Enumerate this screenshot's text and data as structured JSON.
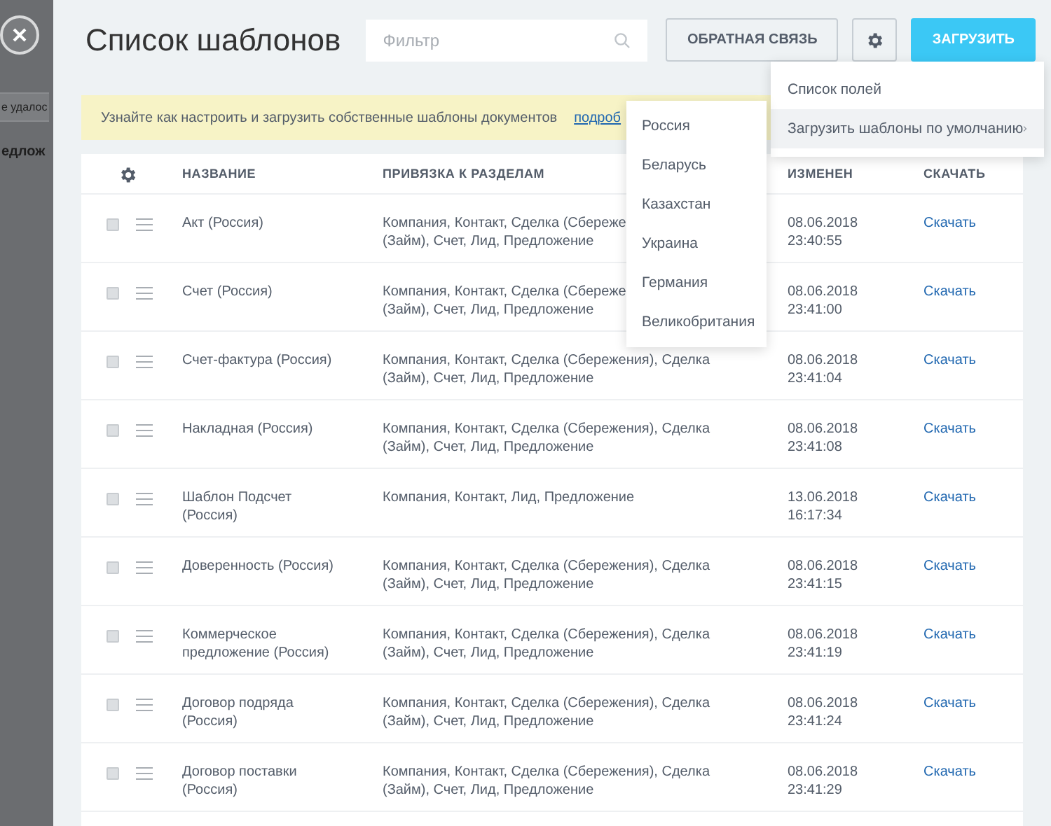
{
  "background_page": {
    "notice": "е удалос",
    "heading": "едлож"
  },
  "title": "Список шаблонов",
  "filter": {
    "placeholder": "Фильтр"
  },
  "buttons": [
    {
      "kind": "outline",
      "label": "ОБРАТНАЯ СВЯЗЬ"
    },
    {
      "kind": "gear"
    },
    {
      "kind": "primary",
      "label": "ЗАГРУЗИТЬ"
    }
  ],
  "banner": {
    "text": "Узнайте как настроить и загрузить собственные шаблоны документов",
    "link": "подроб"
  },
  "table": {
    "columns": [
      "НАЗВАНИЕ",
      "ПРИВЯЗКА К РАЗДЕЛАМ",
      "ИЗМЕНЕН",
      "СКАЧАТЬ"
    ],
    "rows": [
      {
        "checked": false,
        "name": "Акт (Россия)",
        "sections": "Компания, Контакт, Сделка (Сбереже\n(Займ), Счет, Лид, Предложение",
        "modified": "08.06.2018\n23:40:55",
        "download": "Скачать"
      },
      {
        "checked": false,
        "name": "Счет (Россия)",
        "sections": "Компания, Контакт, Сделка (Сбереже\n(Займ), Счет, Лид, Предложение",
        "modified": "08.06.2018\n23:41:00",
        "download": "Скачать"
      },
      {
        "checked": false,
        "name": "Счет-фактура (Россия)",
        "sections": "Компания, Контакт, Сделка (Сбережения), Сделка\n(Займ), Счет, Лид, Предложение",
        "modified": "08.06.2018\n23:41:04",
        "download": "Скачать"
      },
      {
        "checked": false,
        "name": "Накладная (Россия)",
        "sections": "Компания, Контакт, Сделка (Сбережения), Сделка\n(Займ), Счет, Лид, Предложение",
        "modified": "08.06.2018\n23:41:08",
        "download": "Скачать"
      },
      {
        "checked": false,
        "name": "Шаблон Подсчет\n(Россия)",
        "sections": "Компания, Контакт, Лид, Предложение",
        "modified": "13.06.2018\n16:17:34",
        "download": "Скачать"
      },
      {
        "checked": false,
        "name": "Доверенность (Россия)",
        "sections": "Компания, Контакт, Сделка (Сбережения), Сделка\n(Займ), Счет, Лид, Предложение",
        "modified": "08.06.2018\n23:41:15",
        "download": "Скачать"
      },
      {
        "checked": false,
        "name": "Коммерческое\nпредложение (Россия)",
        "sections": "Компания, Контакт, Сделка (Сбережения), Сделка\n(Займ), Счет, Лид, Предложение",
        "modified": "08.06.2018\n23:41:19",
        "download": "Скачать"
      },
      {
        "checked": false,
        "name": "Договор подряда\n(Россия)",
        "sections": "Компания, Контакт, Сделка (Сбережения), Сделка\n(Займ), Счет, Лид, Предложение",
        "modified": "08.06.2018\n23:41:24",
        "download": "Скачать"
      },
      {
        "checked": false,
        "name": "Договор поставки\n(Россия)",
        "sections": "Компания, Контакт, Сделка (Сбережения), Сделка\n(Займ), Счет, Лид, Предложение",
        "modified": "08.06.2018\n23:41:29",
        "download": "Скачать"
      }
    ]
  },
  "settings_menu": {
    "items": [
      {
        "label": "Список полей",
        "selected": false,
        "has_submenu": false
      },
      {
        "label": "Загрузить шаблоны по умолчанию",
        "selected": true,
        "has_submenu": true
      }
    ]
  },
  "submenu": {
    "items": [
      "Россия",
      "Беларусь",
      "Казахстан",
      "Украина",
      "Германия",
      "Великобритания"
    ]
  }
}
